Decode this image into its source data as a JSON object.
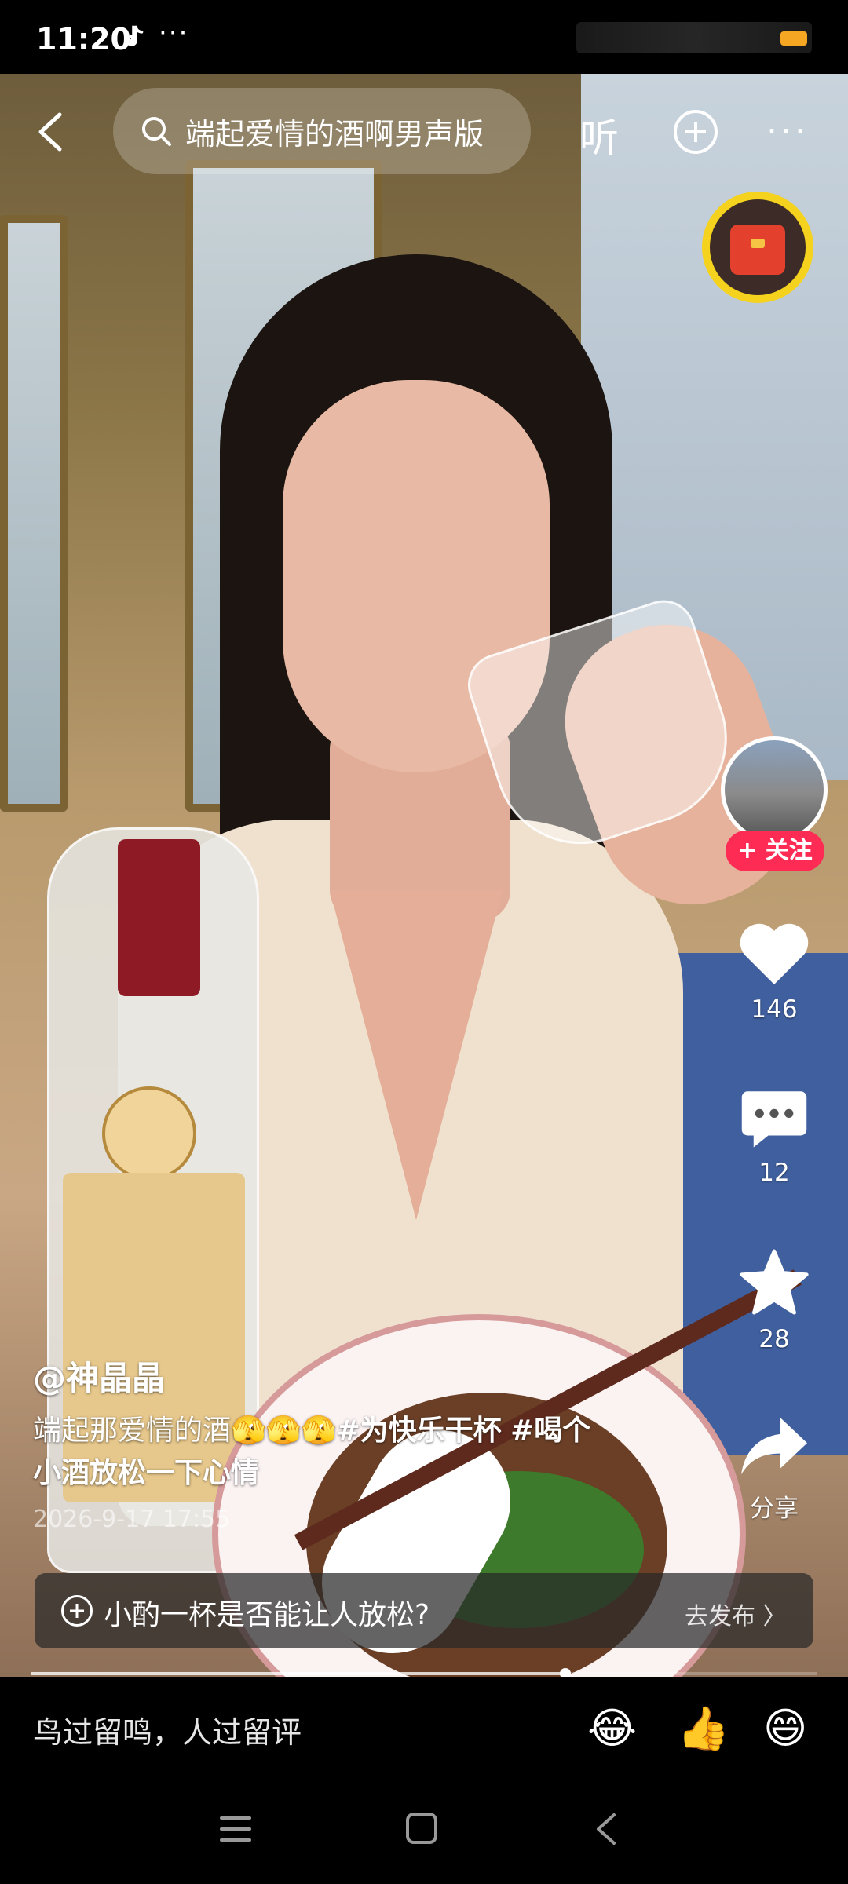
{
  "status_bar": {
    "time": "11:20"
  },
  "top_bar": {
    "search_text": "端起爱情的酒啊男声版",
    "listen_label": "听"
  },
  "right_rail": {
    "follow_label": "+ 关注",
    "like_count": "146",
    "comment_count": "12",
    "favorite_count": "28",
    "share_label": "分享"
  },
  "post": {
    "author": "@神晶晶",
    "caption_text": "端起那爱情的酒",
    "caption_emojis": "🫣🫣🫣",
    "hashtag_1": "#为快乐干杯",
    "hashtag_2": "#喝个",
    "caption_line2": "小酒放松一下心情",
    "timestamp": "2026-9-17 17:55"
  },
  "topic_bar": {
    "text": "小酌一杯是否能让人放松?",
    "action": "去发布 〉"
  },
  "video_progress": 0.68,
  "comment_bar": {
    "placeholder": "鸟过留鸣，人过留评",
    "emojis": [
      "😂",
      "👍",
      "😄"
    ]
  },
  "colors": {
    "follow_red": "#fe2c55",
    "redpacket_ring": "#f5d21d",
    "redpacket_body": "#e3412d"
  }
}
